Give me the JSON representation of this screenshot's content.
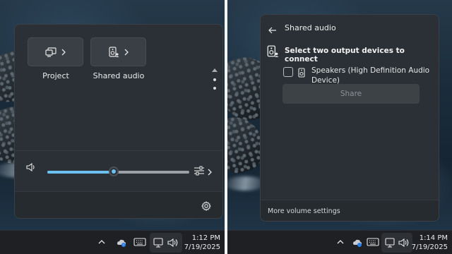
{
  "quick_settings": {
    "tiles": [
      {
        "label": "Project",
        "icon": "project-icon"
      },
      {
        "label": "Shared audio",
        "icon": "shared-audio-icon"
      }
    ],
    "volume": {
      "level": 0.47,
      "icon": "speaker-icon"
    },
    "settings_icon": "gear-icon"
  },
  "shared_audio": {
    "title": "Shared audio",
    "heading": "Select two output devices to connect",
    "devices": [
      {
        "name": "Speakers (High Definition Audio Device)",
        "checked": false
      }
    ],
    "share_label": "Share",
    "more_settings_label": "More volume settings"
  },
  "taskbar_left": {
    "time": "1:12 PM",
    "date": "7/19/2025"
  },
  "taskbar_right": {
    "time": "1:14 PM",
    "date": "7/19/2025"
  },
  "colors": {
    "accent": "#6cc0f0",
    "panel": "#2b3036",
    "taskbar": "#1e2023"
  }
}
